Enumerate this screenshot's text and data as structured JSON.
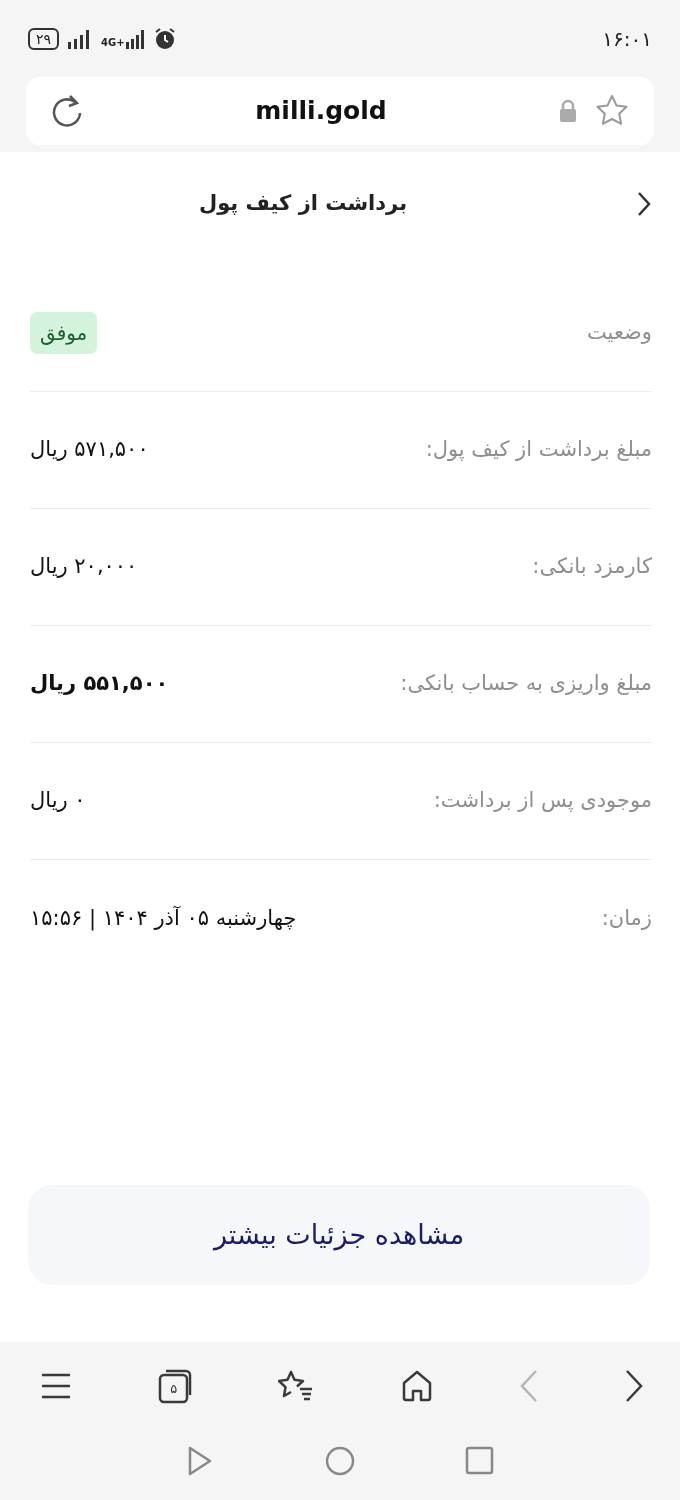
{
  "status_bar": {
    "battery": "۲۹",
    "network": "4G+",
    "time": "۱۶:۰۱"
  },
  "address_bar": {
    "url": "milli.gold",
    "secure": true,
    "bookmarked": false
  },
  "header": {
    "title": "برداشت از کیف پول"
  },
  "rows": [
    {
      "label": "وضعیت",
      "value": "موفق",
      "kind": "badge",
      "bold": false
    },
    {
      "label": "مبلغ برداشت از کیف پول:",
      "value": "۵۷۱,۵۰۰ ریال",
      "kind": "text",
      "bold": false
    },
    {
      "label": "کارمزد بانکی:",
      "value": "۲۰,۰۰۰ ریال",
      "kind": "text",
      "bold": false
    },
    {
      "label": "مبلغ واریزی به حساب بانکی:",
      "value": "۵۵۱,۵۰۰ ریال",
      "kind": "text",
      "bold": true
    },
    {
      "label": "موجودی پس از برداشت:",
      "value": "۰ ریال",
      "kind": "text",
      "bold": false
    },
    {
      "label": "زمان:",
      "value": "چهارشنبه ۰۵ آذر ۱۴۰۴ | ۱۵:۵۶",
      "kind": "text",
      "bold": false
    }
  ],
  "action_button": {
    "label": "مشاهده جزئیات بیشتر"
  },
  "browser_toolbar": [
    {
      "kind": "menu",
      "disabled": false
    },
    {
      "kind": "tabs",
      "label": "۵",
      "disabled": false
    },
    {
      "kind": "bookmarks",
      "disabled": false
    },
    {
      "kind": "home",
      "disabled": false
    },
    {
      "kind": "back",
      "disabled": true
    },
    {
      "kind": "forward",
      "disabled": false
    }
  ],
  "system_nav": [
    {
      "kind": "back"
    },
    {
      "kind": "home"
    },
    {
      "kind": "recents"
    }
  ]
}
